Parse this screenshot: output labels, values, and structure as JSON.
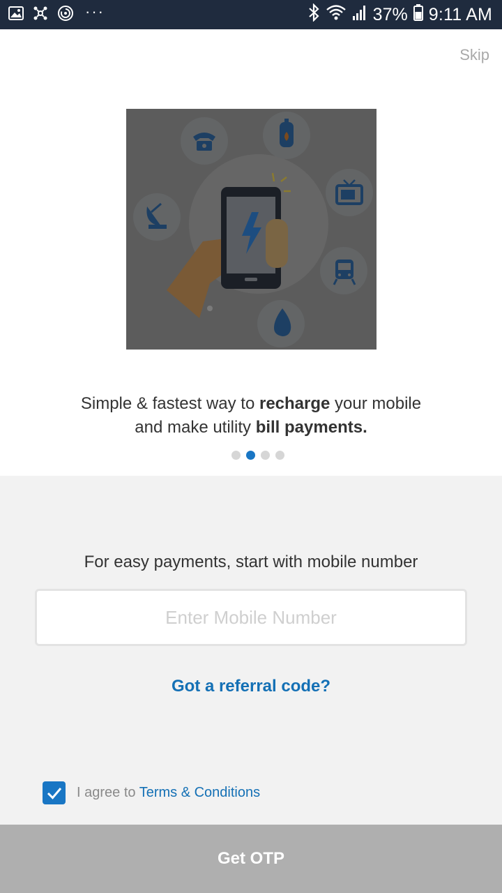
{
  "status_bar": {
    "battery": "37%",
    "time": "9:11 AM",
    "left_icons": [
      "gallery-icon",
      "network-icon",
      "sync-icon",
      "more-dots-icon"
    ],
    "right_icons": [
      "bluetooth-icon",
      "wifi-icon",
      "signal-icon",
      "battery-icon"
    ],
    "more_dots": "···"
  },
  "onboarding": {
    "skip_label": "Skip",
    "tagline": {
      "part1": "Simple & fastest way to ",
      "bold1": "recharge",
      "part2": " your mobile",
      "part3": "and make utility ",
      "bold2": "bill payments."
    },
    "pager": {
      "count": 4,
      "active_index": 1
    },
    "hero_icons": [
      "telephone-icon",
      "gas-cylinder-icon",
      "tv-icon",
      "dth-dish-icon",
      "phone-recharge-icon",
      "train-icon",
      "water-drop-icon"
    ]
  },
  "login": {
    "prompt": "For easy payments, start with mobile number",
    "mobile_placeholder": "Enter Mobile Number",
    "referral_label": "Got a referral code?",
    "agree_prefix": "I agree to ",
    "terms_label": "Terms & Conditions",
    "agree_checked": true,
    "otp_button_label": "Get OTP"
  },
  "colors": {
    "status_bar_bg": "#1f2b3e",
    "accent_blue": "#1976c4",
    "link_blue": "#1470b5",
    "panel_bg": "#f2f2f2",
    "button_disabled_bg": "#afafaf",
    "hero_overlay": "#5c5c5c"
  }
}
